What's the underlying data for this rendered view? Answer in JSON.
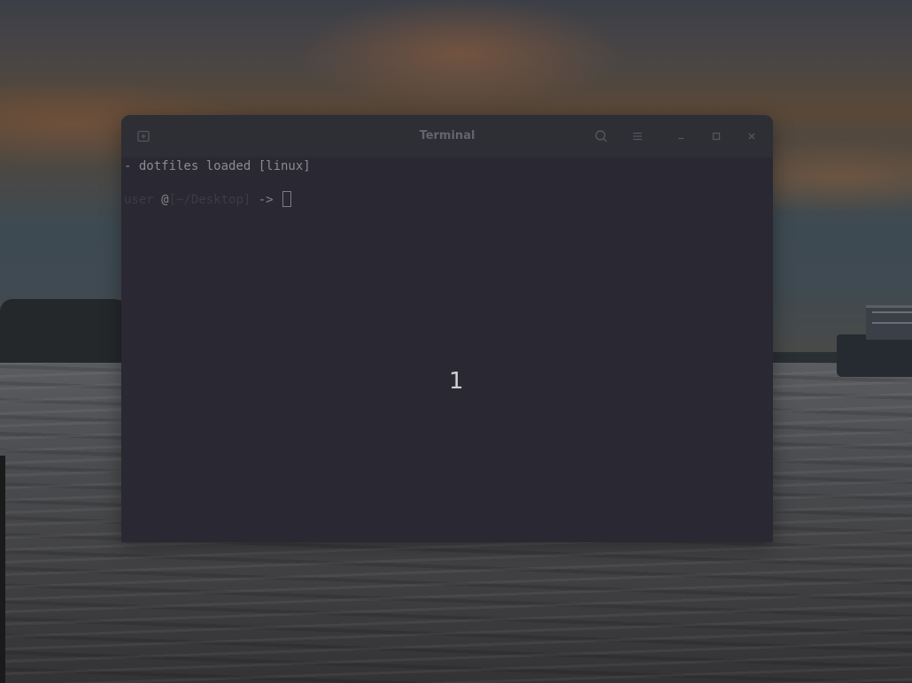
{
  "window": {
    "title": "Terminal"
  },
  "terminal": {
    "line1": "- dotfiles loaded [linux]",
    "prompt_user": "user",
    "prompt_at": "@",
    "prompt_path": "[~/Desktop]",
    "prompt_arrow": "->"
  },
  "overlay": {
    "workspace_number": "1"
  },
  "icons": {
    "new_tab": "new-tab-icon",
    "search": "search-icon",
    "menu": "hamburger-menu-icon",
    "minimize": "minimize-icon",
    "maximize": "maximize-icon",
    "close": "close-icon"
  },
  "colors": {
    "terminal_bg": "#2a2832",
    "titlebar_bg": "#2e2e35",
    "text": "#8c8b90",
    "prompt_dim": "#3c3c47"
  }
}
